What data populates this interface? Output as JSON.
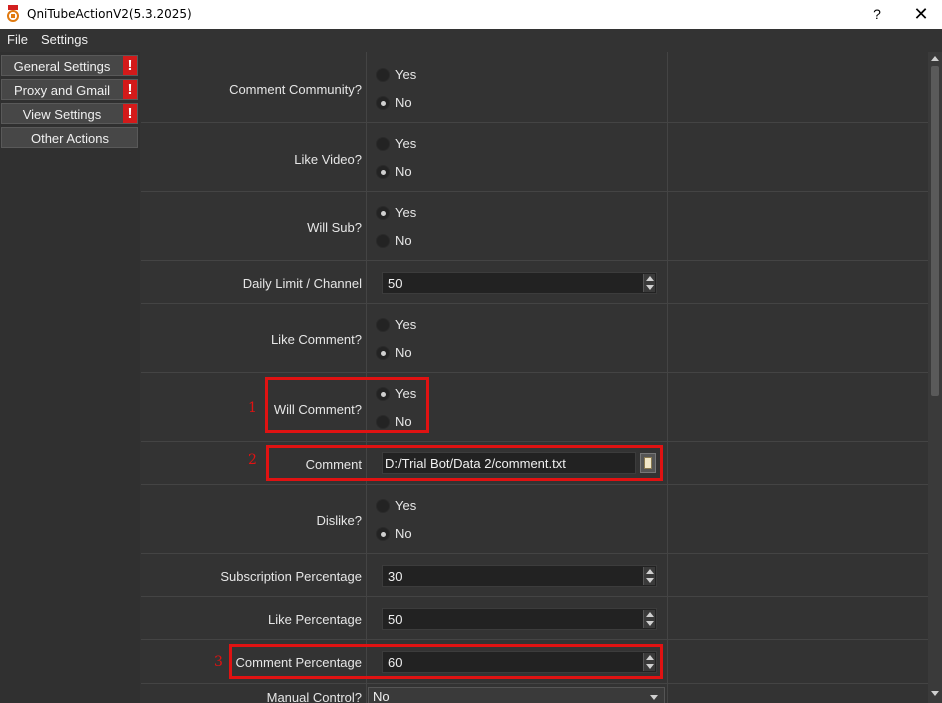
{
  "window": {
    "title": "QniTubeActionV2(5.3.2025)",
    "help_glyph": "?",
    "close_glyph": "✕",
    "app_icon": "app-icon"
  },
  "menu": {
    "file": "File",
    "settings": "Settings"
  },
  "sidebar": {
    "items": [
      {
        "label": "General Settings",
        "warning": "!"
      },
      {
        "label": "Proxy and Gmail",
        "warning": "!"
      },
      {
        "label": "View Settings",
        "warning": "!"
      },
      {
        "label": "Other Actions"
      }
    ]
  },
  "form": {
    "comment_community": {
      "label": "Comment Community?",
      "yes": "Yes",
      "no": "No",
      "selected": "No"
    },
    "like_video": {
      "label": "Like Video?",
      "yes": "Yes",
      "no": "No",
      "selected": "No"
    },
    "will_sub": {
      "label": "Will Sub?",
      "yes": "Yes",
      "no": "No",
      "selected": "Yes"
    },
    "daily_limit": {
      "label": "Daily Limit / Channel",
      "value": "50"
    },
    "like_comment": {
      "label": "Like Comment?",
      "yes": "Yes",
      "no": "No",
      "selected": "No"
    },
    "will_comment": {
      "label": "Will Comment?",
      "yes": "Yes",
      "no": "No",
      "selected": "Yes"
    },
    "comment": {
      "label": "Comment",
      "value": "D:/Trial Bot/Data 2/comment.txt"
    },
    "dislike": {
      "label": "Dislike?",
      "yes": "Yes",
      "no": "No",
      "selected": "No"
    },
    "subscription_percentage": {
      "label": "Subscription Percentage",
      "value": "30"
    },
    "like_percentage": {
      "label": "Like Percentage",
      "value": "50"
    },
    "comment_percentage": {
      "label": "Comment Percentage",
      "value": "60"
    },
    "manual_control": {
      "label": "Manual Control?",
      "value": "No"
    }
  },
  "annotations": {
    "marker_1": "1",
    "marker_2": "2",
    "marker_3": "3",
    "color": "#e01212"
  },
  "colors": {
    "background": "#333333",
    "warning": "#d31a1a",
    "highlight": "#e01212"
  }
}
